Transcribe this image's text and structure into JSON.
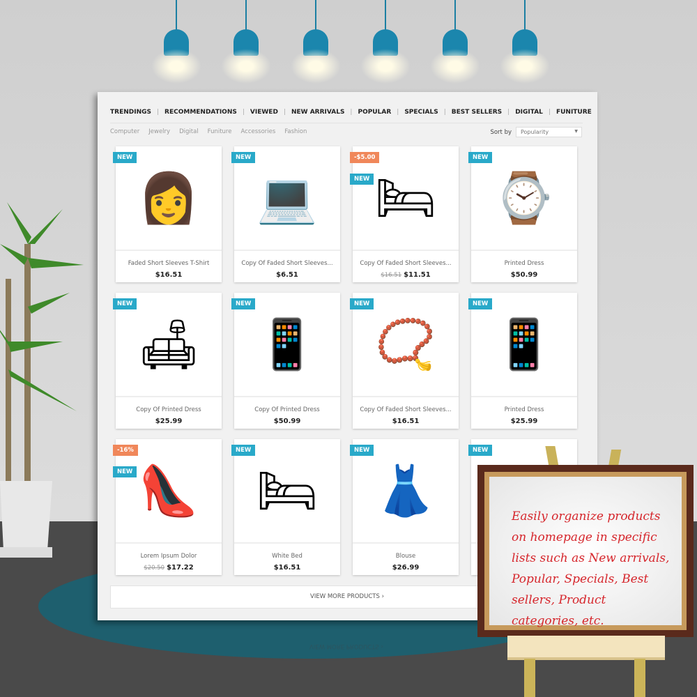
{
  "tabs": [
    "TRENDINGS",
    "RECOMMENDATIONS",
    "VIEWED",
    "NEW ARRIVALS",
    "POPULAR",
    "SPECIALS",
    "BEST SELLERS",
    "DIGITAL",
    "FUNITURE"
  ],
  "categories": [
    "Computer",
    "Jewelry",
    "Digital",
    "Funiture",
    "Accessories",
    "Fashion"
  ],
  "sort": {
    "label": "Sort by",
    "value": "Popularity"
  },
  "products": [
    {
      "name": "Faded Short Sleeves T-Shirt",
      "price": "$16.51",
      "old_price": "",
      "badges": [
        "NEW"
      ],
      "icon": "👩"
    },
    {
      "name": "Copy Of Faded Short Sleeves...",
      "price": "$6.51",
      "old_price": "",
      "badges": [
        "NEW"
      ],
      "icon": "💻"
    },
    {
      "name": "Copy Of Faded Short Sleeves...",
      "price": "$11.51",
      "old_price": "$16.51",
      "badges": [
        "-$5.00",
        "NEW"
      ],
      "icon": "🛏"
    },
    {
      "name": "Printed Dress",
      "price": "$50.99",
      "old_price": "",
      "badges": [
        "NEW"
      ],
      "icon": "⌚"
    },
    {
      "name": "Copy Of Printed Dress",
      "price": "$25.99",
      "old_price": "",
      "badges": [
        "NEW"
      ],
      "icon": "🛋"
    },
    {
      "name": "Copy Of Printed Dress",
      "price": "$50.99",
      "old_price": "",
      "badges": [
        "NEW"
      ],
      "icon": "📱"
    },
    {
      "name": "Copy Of Faded Short Sleeves...",
      "price": "$16.51",
      "old_price": "",
      "badges": [
        "NEW"
      ],
      "icon": "📿"
    },
    {
      "name": "Printed Dress",
      "price": "$25.99",
      "old_price": "",
      "badges": [
        "NEW"
      ],
      "icon": "📱"
    },
    {
      "name": "Lorem Ipsum Dolor",
      "price": "$17.22",
      "old_price": "$20.50",
      "badges": [
        "-16%",
        "NEW"
      ],
      "icon": "👠"
    },
    {
      "name": "White Bed",
      "price": "$16.51",
      "old_price": "",
      "badges": [
        "NEW"
      ],
      "icon": "🛏"
    },
    {
      "name": "Blouse",
      "price": "$26.99",
      "old_price": "",
      "badges": [
        "NEW"
      ],
      "icon": "👗"
    },
    {
      "name": "",
      "price": "",
      "old_price": "",
      "badges": [
        "NEW"
      ],
      "icon": "📷"
    }
  ],
  "view_more": "VIEW MORE PRODUCTS",
  "sign_text": "Easily organize products on homepage in specific lists such as New arrivals, Popular, Specials, Best sellers, Product categories, etc.",
  "colors": {
    "badge_new": "#29a9c9",
    "badge_sale": "#f0875a",
    "lamp": "#1b86ad",
    "sign_text": "#d6262c"
  }
}
